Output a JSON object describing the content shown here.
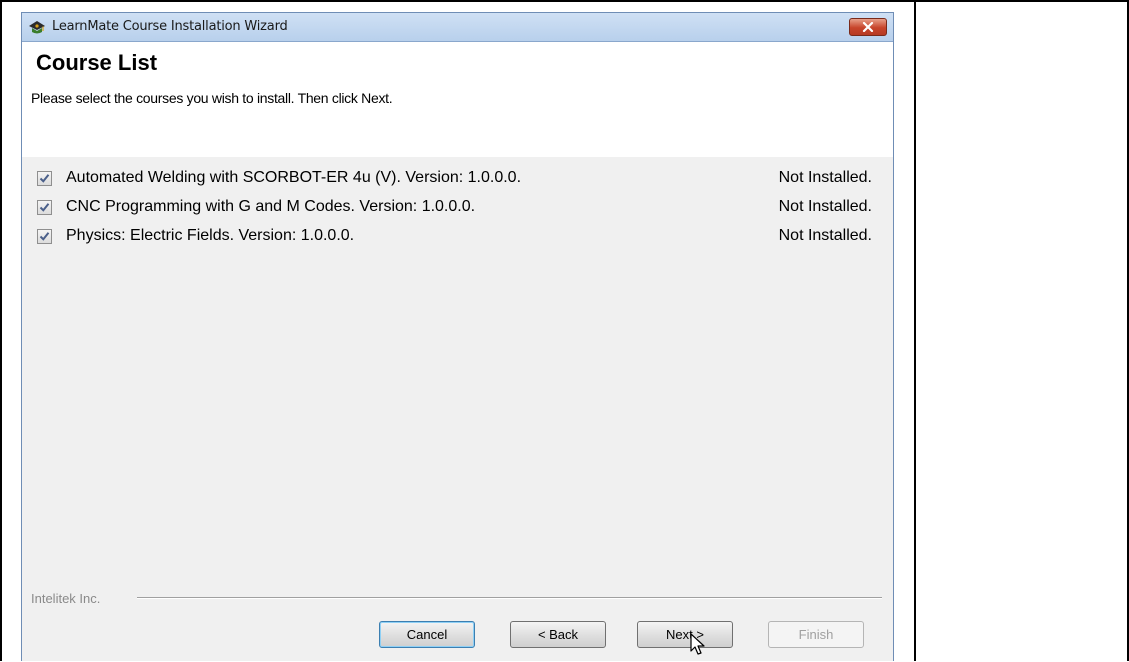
{
  "window": {
    "title": "LearnMate Course Installation Wizard",
    "app_icon": "learnmate-app-icon",
    "close_icon": "close-icon"
  },
  "header": {
    "title": "Course List",
    "instructions": "Please select the courses you wish to install. Then click Next."
  },
  "courses": [
    {
      "name": "Automated Welding with SCORBOT-ER 4u (V).  Version: 1.0.0.0.",
      "status": "Not Installed.",
      "checked": true
    },
    {
      "name": "CNC Programming with G and M Codes.  Version: 1.0.0.0.",
      "status": "Not Installed.",
      "checked": true
    },
    {
      "name": "Physics: Electric Fields.  Version: 1.0.0.0.",
      "status": "Not Installed.",
      "checked": true
    }
  ],
  "footer": {
    "company": "Intelitek Inc.",
    "cancel_label": "Cancel",
    "back_label": "< Back",
    "next_label": "Next >",
    "finish_label": "Finish"
  }
}
